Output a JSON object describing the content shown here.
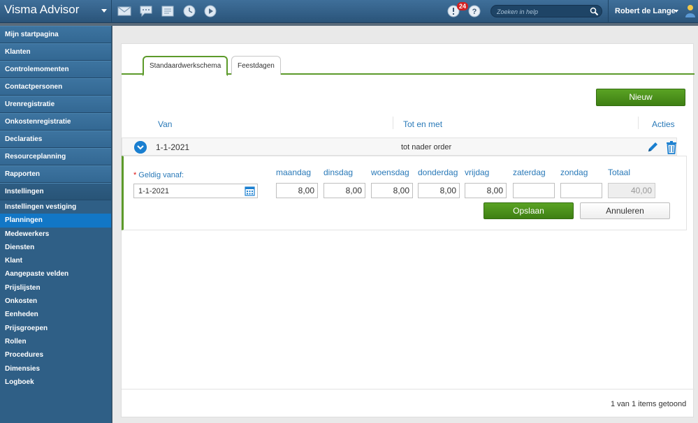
{
  "app": {
    "title": "Visma Advisor",
    "notifications_count": "24",
    "search_placeholder": "Zoeken in help",
    "user_name": "Robert de Lange"
  },
  "sidebar": {
    "main_items": [
      "Mijn startpagina",
      "Klanten",
      "Controlemomenten",
      "Contactpersonen",
      "Urenregistratie",
      "Onkostenregistratie",
      "Declaraties",
      "Resourceplanning",
      "Rapporten",
      "Instellingen"
    ],
    "sub_items": [
      "Instellingen vestiging",
      "Planningen",
      "Medewerkers",
      "Diensten",
      "Klant",
      "Aangepaste velden",
      "Prijslijsten",
      "Onkosten",
      "Eenheden",
      "Prijsgroepen",
      "Rollen",
      "Procedures",
      "Dimensies",
      "Logboek"
    ]
  },
  "tabs": [
    "Standaardwerkschema",
    "Feestdagen"
  ],
  "toolbar": {
    "new_label": "Nieuw"
  },
  "table": {
    "headers": {
      "van": "Van",
      "tot": "Tot en met",
      "acties": "Acties"
    },
    "row": {
      "van": "1-1-2021",
      "tot": "tot nader order"
    }
  },
  "editor": {
    "valid_from_label": "Geldig vanaf:",
    "valid_from_value": "1-1-2021",
    "days": [
      {
        "label": "maandag",
        "value": "8,00"
      },
      {
        "label": "dinsdag",
        "value": "8,00"
      },
      {
        "label": "woensdag",
        "value": "8,00"
      },
      {
        "label": "donderdag",
        "value": "8,00"
      },
      {
        "label": "vrijdag",
        "value": "8,00"
      },
      {
        "label": "zaterdag",
        "value": ""
      },
      {
        "label": "zondag",
        "value": ""
      }
    ],
    "total_label": "Totaal",
    "total_value": "40,00",
    "save_label": "Opslaan",
    "cancel_label": "Annuleren"
  },
  "footer": {
    "items_shown": "1 van 1 items getoond"
  },
  "colors": {
    "accent_green": "#5c9a2a",
    "link_blue": "#2979b8",
    "sidebar_blue": "#2f5f86"
  }
}
